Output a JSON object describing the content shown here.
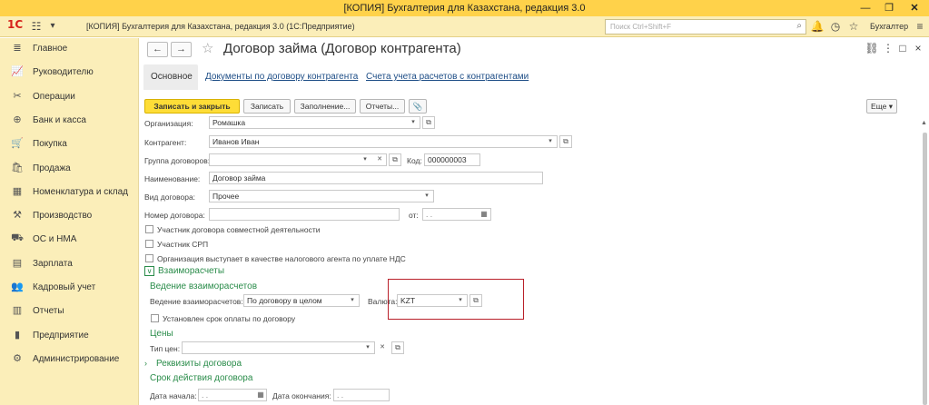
{
  "window": {
    "title": "[КОПИЯ] Бухгалтерия для Казахстана, редакция 3.0"
  },
  "appbar": {
    "logo": "1С",
    "title": "[КОПИЯ] Бухгалтерия для Казахстана, редакция 3.0  (1С:Предприятие)",
    "search_placeholder": "Поиск Ctrl+Shift+F",
    "user": "Бухгалтер"
  },
  "sidebar": {
    "items": [
      {
        "label": "Главное",
        "icon": "menu-icon"
      },
      {
        "label": "Руководителю",
        "icon": "chart-icon"
      },
      {
        "label": "Операции",
        "icon": "operations-icon"
      },
      {
        "label": "Банк и касса",
        "icon": "bank-icon"
      },
      {
        "label": "Покупка",
        "icon": "cart-icon"
      },
      {
        "label": "Продажа",
        "icon": "bag-icon"
      },
      {
        "label": "Номенклатура и склад",
        "icon": "warehouse-icon"
      },
      {
        "label": "Производство",
        "icon": "factory-icon"
      },
      {
        "label": "ОС и НМА",
        "icon": "truck-icon"
      },
      {
        "label": "Зарплата",
        "icon": "salary-icon"
      },
      {
        "label": "Кадровый учет",
        "icon": "people-icon"
      },
      {
        "label": "Отчеты",
        "icon": "reports-icon"
      },
      {
        "label": "Предприятие",
        "icon": "enterprise-icon"
      },
      {
        "label": "Администрирование",
        "icon": "gear-icon"
      }
    ]
  },
  "form": {
    "title": "Договор займа (Договор контрагента)",
    "tabs": {
      "main": "Основное",
      "documents": "Документы по договору контрагента",
      "accounts": "Счета учета расчетов с контрагентами"
    },
    "toolbar": {
      "save_close": "Записать и закрыть",
      "save": "Записать",
      "fill": "Заполнение...",
      "reports": "Отчеты...",
      "more": "Еще"
    },
    "fields": {
      "organization_label": "Организация:",
      "organization_value": "Ромашка",
      "counterparty_label": "Контрагент:",
      "counterparty_value": "Иванов Иван",
      "group_label": "Группа договоров:",
      "group_value": "",
      "code_label": "Код:",
      "code_value": "000000003",
      "name_label": "Наименование:",
      "name_value": "Договор займа",
      "type_label": "Вид договора:",
      "type_value": "Прочее",
      "number_label": "Номер договора:",
      "number_value": "",
      "from_label": "от:",
      "from_value": ". .",
      "joint_activity": "Участник договора совместной деятельности",
      "srp": "Участник СРП",
      "tax_agent": "Организация выступает в качестве налогового агента по уплате НДС"
    },
    "settlements": {
      "section": "Взаиморасчеты",
      "subsection": "Ведение взаиморасчетов",
      "mode_label": "Ведение взаиморасчетов:",
      "mode_value": "По договору в целом",
      "currency_label": "Валюта:",
      "currency_value": "KZT",
      "payment_term": "Установлен срок оплаты по договору"
    },
    "prices": {
      "section": "Цены",
      "type_label": "Тип цен:",
      "type_value": ""
    },
    "details": {
      "section": "Реквизиты договора",
      "validity": "Срок действия договора",
      "start_label": "Дата начала:",
      "start_value": ". .",
      "end_label": "Дата окончания:",
      "end_value": ". ."
    }
  }
}
